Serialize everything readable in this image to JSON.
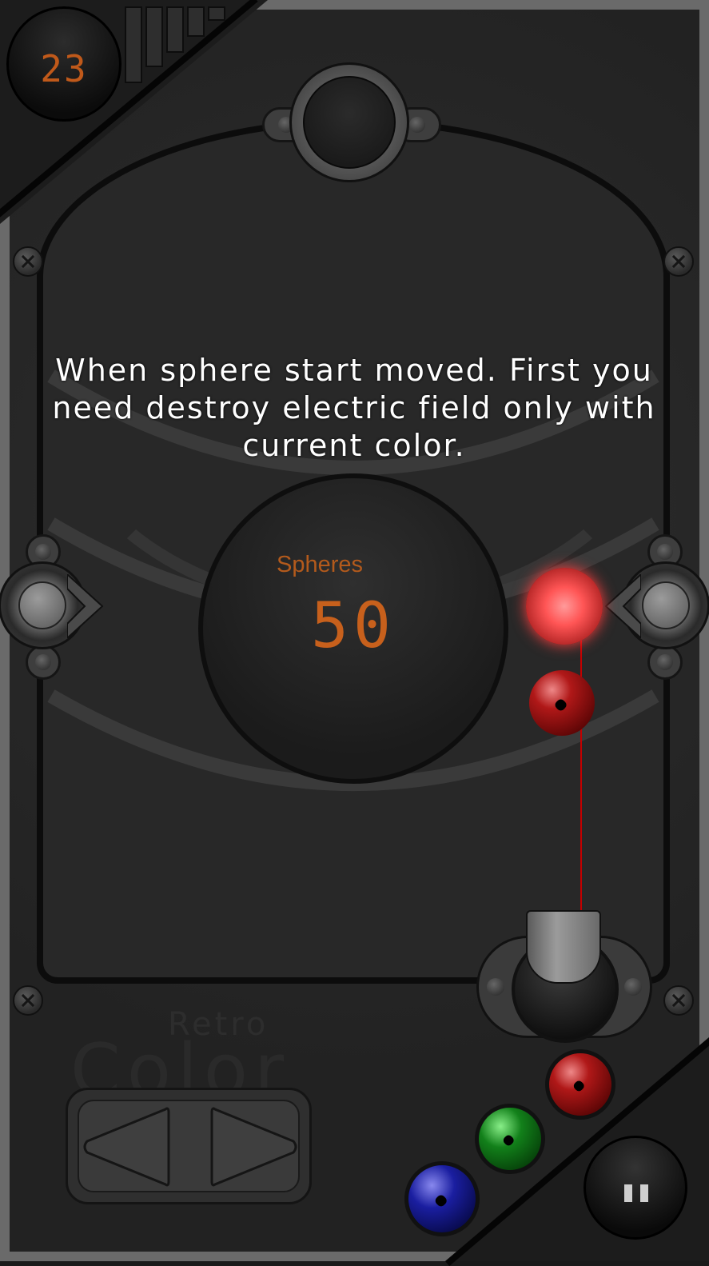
{
  "hud": {
    "level": "23",
    "level_bars": 5
  },
  "tutorial": {
    "text": "When sphere start moved. First you need destroy electric field only with current color."
  },
  "spheres_panel": {
    "label": "Spheres",
    "value": "50"
  },
  "logo": {
    "small": "Retro",
    "big": "Color"
  },
  "queue": {
    "spheres": [
      "red",
      "green",
      "blue"
    ]
  },
  "colors": {
    "accent_orange": "#c7601c",
    "laser_red": "#c40000",
    "sphere_red": "#b01818",
    "sphere_green": "#12801a",
    "sphere_blue": "#1a1ea0"
  },
  "icons": {
    "left_arrow": "triangle-left-icon",
    "right_arrow": "triangle-right-icon",
    "pause": "pause-icon"
  }
}
